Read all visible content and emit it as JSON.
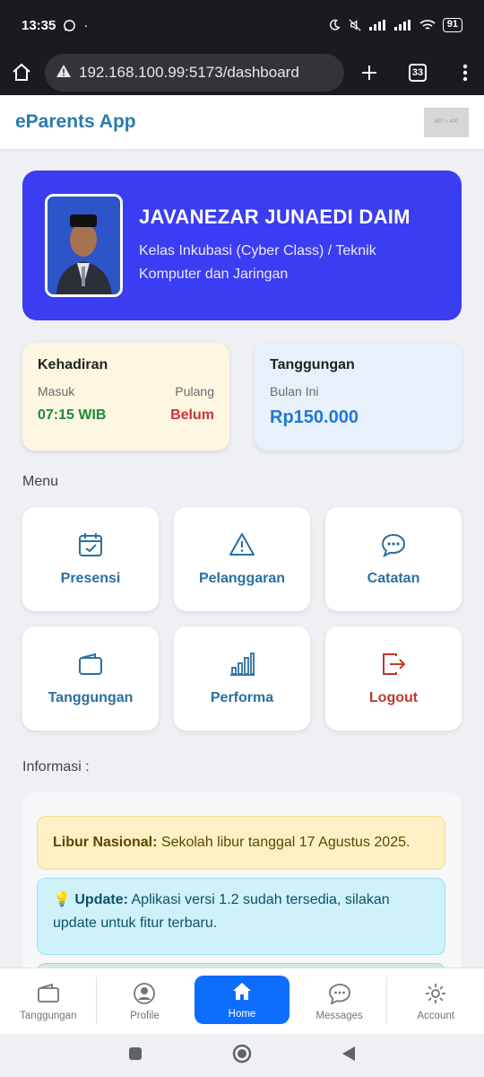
{
  "status_bar": {
    "time": "13:35",
    "battery": "91"
  },
  "browser": {
    "url": "192.168.100.99:5173/dashboard",
    "tab_count": "33"
  },
  "app": {
    "brand": "eParents App",
    "logo_placeholder": "600 × 400"
  },
  "profile": {
    "name": "JAVANEZAR JUNAEDI DAIM",
    "class_line1": "Kelas Inkubasi (Cyber Class) / Teknik",
    "class_line2": "Komputer dan Jaringan"
  },
  "attendance": {
    "title": "Kehadiran",
    "in_label": "Masuk",
    "out_label": "Pulang",
    "in_value": "07:15 WIB",
    "out_value": "Belum"
  },
  "bill": {
    "title": "Tanggungan",
    "period": "Bulan Ini",
    "amount": "Rp150.000"
  },
  "menu": {
    "title": "Menu",
    "items": [
      {
        "label": "Presensi",
        "icon": "calendar-check-icon"
      },
      {
        "label": "Pelanggaran",
        "icon": "warning-triangle-icon"
      },
      {
        "label": "Catatan",
        "icon": "chat-dots-icon"
      },
      {
        "label": "Tanggungan",
        "icon": "wallet-icon"
      },
      {
        "label": "Performa",
        "icon": "bar-chart-icon"
      },
      {
        "label": "Logout",
        "icon": "logout-icon"
      }
    ]
  },
  "info": {
    "title": "Informasi :",
    "alert1_bold": "Libur Nasional:",
    "alert1_text": " Sekolah libur tanggal 17 Agustus 2025.",
    "alert2_emoji": "💡",
    "alert2_bold": "Update:",
    "alert2_text": " Aplikasi versi 1.2 sudah tersedia, silakan update untuk fitur terbaru."
  },
  "bottom_nav": [
    {
      "label": "Tanggungan"
    },
    {
      "label": "Profile"
    },
    {
      "label": "Home"
    },
    {
      "label": "Messages"
    },
    {
      "label": "Account"
    }
  ],
  "colors": {
    "brand": "#2a7bab",
    "profile_bg": "#3b3df2",
    "active_nav": "#0d6efd",
    "logout": "#c0392b"
  }
}
